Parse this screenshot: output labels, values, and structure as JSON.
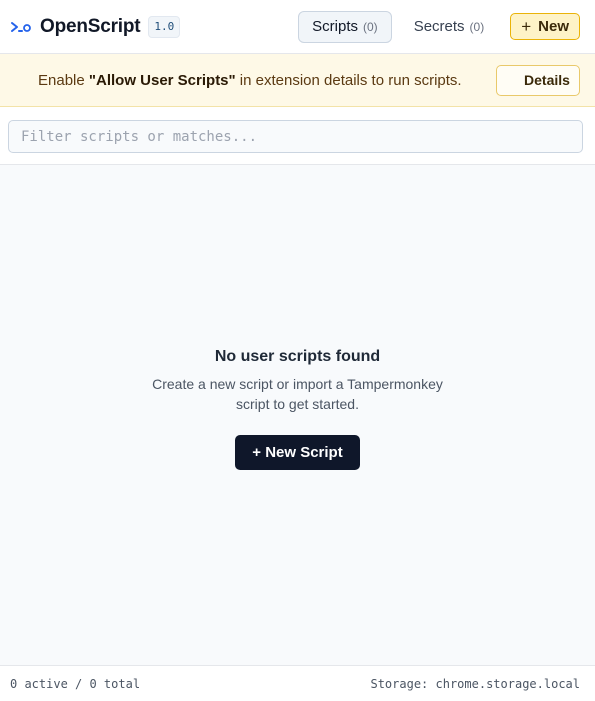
{
  "header": {
    "app_title": "OpenScript",
    "version": "1.0",
    "tabs": [
      {
        "label": "Scripts",
        "count": "(0)",
        "active": true
      },
      {
        "label": "Secrets",
        "count": "(0)",
        "active": false
      }
    ],
    "new_button": {
      "icon": "+",
      "label": "New"
    }
  },
  "banner": {
    "prefix": "Enable ",
    "highlight": "\"Allow User Scripts\"",
    "suffix": " in extension details to run scripts.",
    "details_button": "Details"
  },
  "filter": {
    "placeholder": "Filter scripts or matches...",
    "value": ""
  },
  "empty_state": {
    "title": "No user scripts found",
    "description": "Create a new script or import a Tampermonkey script to get started.",
    "button": "+ New Script"
  },
  "footer": {
    "stats": "0 active / 0 total",
    "storage": "Storage: chrome.storage.local"
  },
  "colors": {
    "accent": "#0f172a",
    "logo": "#2563eb",
    "warning_bg": "#fef9e7",
    "new_button_bg": "#fef3c7"
  },
  "icons": {
    "logo": "prompt-icon"
  }
}
